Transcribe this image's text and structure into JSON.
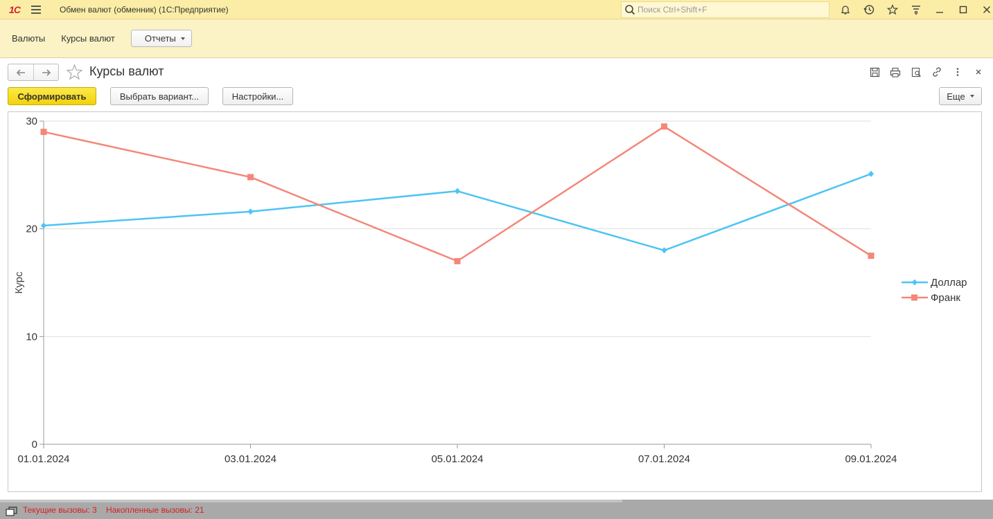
{
  "window": {
    "logo_text": "1С",
    "title": "Обмен валют (обменник)  (1С:Предприятие)",
    "search_placeholder": "Поиск Ctrl+Shift+F"
  },
  "sections": {
    "items": [
      "Валюты",
      "Курсы валют"
    ],
    "reports_label": "Отчеты"
  },
  "form": {
    "title": "Курсы валют",
    "generate_label": "Сформировать",
    "variant_label": "Выбрать вариант...",
    "settings_label": "Настройки...",
    "more_label": "Еще"
  },
  "chart_data": {
    "type": "line",
    "ylabel": "Курс",
    "ylim": [
      0,
      30
    ],
    "yticks": [
      0,
      10,
      20,
      30
    ],
    "x": [
      "01.01.2024",
      "03.01.2024",
      "05.01.2024",
      "07.01.2024",
      "09.01.2024"
    ],
    "grid": true,
    "legend": "right",
    "series": [
      {
        "name": "Доллар",
        "color": "#4dc4f4",
        "marker": "diamond",
        "values": [
          20.3,
          21.6,
          23.5,
          18.0,
          25.1
        ]
      },
      {
        "name": "Франк",
        "color": "#f4877a",
        "marker": "square",
        "values": [
          29.0,
          24.8,
          17.0,
          29.5,
          17.5
        ]
      }
    ]
  },
  "footer": {
    "current_calls": "Текущие вызовы: 3",
    "accumulated_calls": "Накопленные вызовы: 21"
  }
}
